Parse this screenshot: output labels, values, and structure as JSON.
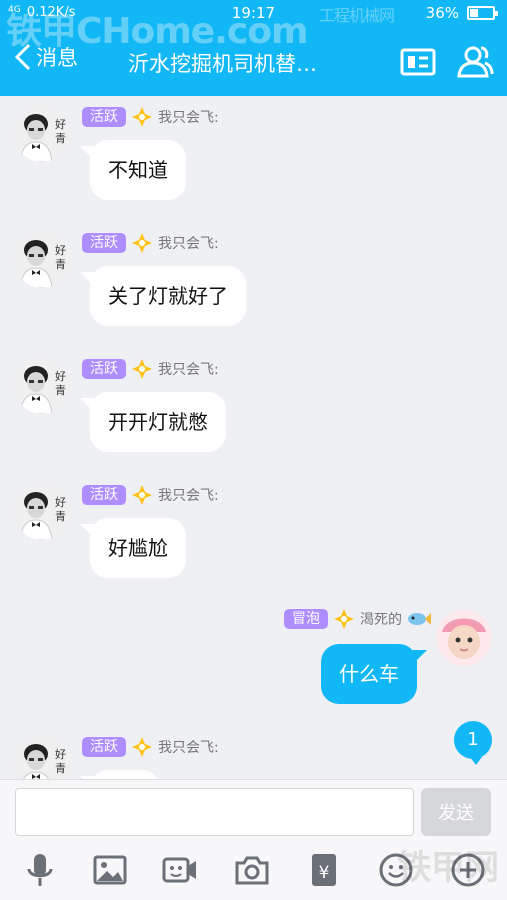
{
  "status_bar": {
    "network": "4G",
    "speed": "0.12K/s",
    "time": "19:17",
    "battery": "36%",
    "battery_level": 0.36
  },
  "watermark": {
    "top_main": "铁甲CHome.com",
    "top_sub": "工程机械网",
    "bottom": "铁甲网"
  },
  "header": {
    "back_label": "消息",
    "title": "沂水挖掘机司机替…",
    "bg_color": "#12b7f5"
  },
  "messages": [
    {
      "direction": "in",
      "badge": "活跃",
      "sender": "我只会飞:",
      "text": "不知道"
    },
    {
      "direction": "in",
      "badge": "活跃",
      "sender": "我只会飞:",
      "text": "关了灯就好了"
    },
    {
      "direction": "in",
      "badge": "活跃",
      "sender": "我只会飞:",
      "text": "开开灯就憋"
    },
    {
      "direction": "in",
      "badge": "活跃",
      "sender": "我只会飞:",
      "text": "好尴尬"
    },
    {
      "direction": "out",
      "badge": "冒泡",
      "sender": "渴死的",
      "text": "什么车"
    },
    {
      "direction": "in",
      "badge": "活跃",
      "sender": "我只会飞:",
      "text": ""
    }
  ],
  "unread_count": "1",
  "input": {
    "value": "",
    "send_label": "发送"
  },
  "toolbar": [
    "microphone-icon",
    "image-icon",
    "video-icon",
    "camera-icon",
    "red-packet-icon",
    "emoji-icon",
    "plus-icon"
  ],
  "colors": {
    "accent": "#12b7f5",
    "badge": "#ae8eff",
    "chat_bg": "#eef0f4"
  }
}
